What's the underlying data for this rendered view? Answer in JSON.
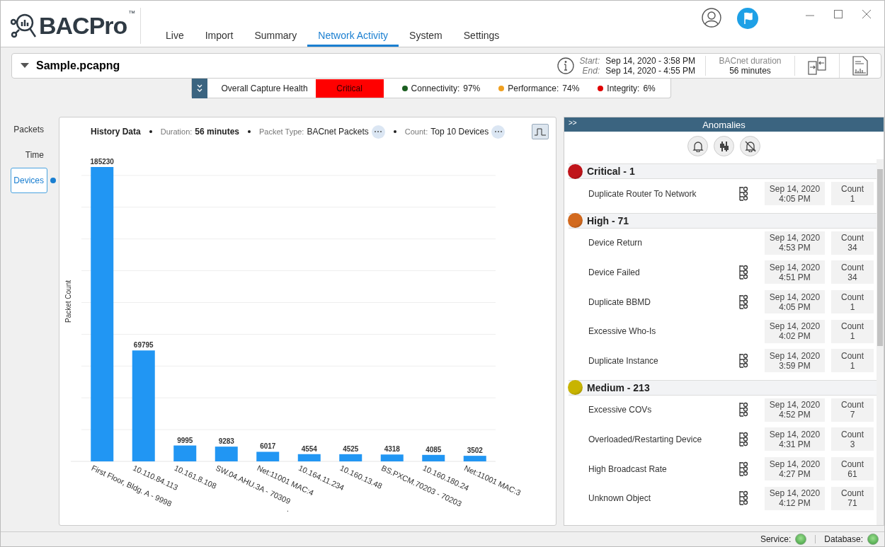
{
  "app": {
    "logo": "BACPro",
    "trademark": "™"
  },
  "tabs": [
    {
      "label": "Live",
      "selected": false
    },
    {
      "label": "Import",
      "selected": false
    },
    {
      "label": "Summary",
      "selected": false
    },
    {
      "label": "Network Activity",
      "selected": true
    },
    {
      "label": "System",
      "selected": false
    },
    {
      "label": "Settings",
      "selected": false
    }
  ],
  "file_bar": {
    "file_name": "Sample.pcapng",
    "start_label": "Start:",
    "start": "Sep 14, 2020 - 3:58 PM",
    "end_label": "End:",
    "end": "Sep 14, 2020 - 4:55 PM",
    "duration_label": "BACnet duration",
    "duration": "56 minutes"
  },
  "health": {
    "label": "Overall Capture Health",
    "status": "Critical",
    "metrics": [
      {
        "label": "Connectivity:",
        "value": "97%",
        "color": "#1b5e20"
      },
      {
        "label": "Performance:",
        "value": "74%",
        "color": "#f0a020"
      },
      {
        "label": "Integrity:",
        "value": "6%",
        "color": "#e00000"
      }
    ]
  },
  "view_tabs": [
    {
      "label": "Packets",
      "selected": false
    },
    {
      "label": "Time",
      "selected": false
    },
    {
      "label": "Devices",
      "selected": true
    }
  ],
  "chart_header": {
    "title": "History Data",
    "duration_label": "Duration:",
    "duration": "56 minutes",
    "packet_type_label": "Packet Type:",
    "packet_type": "BACnet Packets",
    "count_label": "Count:",
    "count": "Top 10 Devices"
  },
  "chart_data": {
    "type": "bar",
    "xlabel": ".",
    "ylabel": "Packet Count",
    "data_labels": true,
    "categories": [
      "First Floor, Bldg. A - 9998",
      "10.110.84.113",
      "10.161.8.108",
      "SW.04.AHU.3A - 70309",
      "Net:11001 MAC:4",
      "10.164.11.234",
      "10.160.13.48",
      "BS.PXCM.70203 - 70203",
      "10.160.180.24",
      "Net:11001 MAC:3"
    ],
    "values": [
      185230,
      69795,
      9995,
      9283,
      6017,
      4554,
      4525,
      4318,
      4085,
      3502
    ]
  },
  "anomalies": {
    "title": "Anomalies",
    "collapse": ">>",
    "groups": [
      {
        "label": "Critical - 1",
        "color": "#c0141a",
        "items": [
          {
            "name": "Duplicate Router To Network",
            "diagram": true,
            "date": "Sep 14, 2020",
            "time": "4:05 PM",
            "count_label": "Count",
            "count": "1"
          }
        ]
      },
      {
        "label": "High - 71",
        "color": "#d2691e",
        "items": [
          {
            "name": "Device Return",
            "diagram": false,
            "date": "Sep 14, 2020",
            "time": "4:53 PM",
            "count_label": "Count",
            "count": "34"
          },
          {
            "name": "Device Failed",
            "diagram": true,
            "date": "Sep 14, 2020",
            "time": "4:51 PM",
            "count_label": "Count",
            "count": "34"
          },
          {
            "name": "Duplicate BBMD",
            "diagram": true,
            "date": "Sep 14, 2020",
            "time": "4:05 PM",
            "count_label": "Count",
            "count": "1"
          },
          {
            "name": "Excessive Who-Is",
            "diagram": false,
            "date": "Sep 14, 2020",
            "time": "4:02 PM",
            "count_label": "Count",
            "count": "1"
          },
          {
            "name": "Duplicate Instance",
            "diagram": true,
            "date": "Sep 14, 2020",
            "time": "3:59 PM",
            "count_label": "Count",
            "count": "1"
          }
        ]
      },
      {
        "label": "Medium - 213",
        "color": "#c8b400",
        "items": [
          {
            "name": "Excessive COVs",
            "diagram": true,
            "date": "Sep 14, 2020",
            "time": "4:52 PM",
            "count_label": "Count",
            "count": "7"
          },
          {
            "name": "Overloaded/Restarting Device",
            "diagram": true,
            "date": "Sep 14, 2020",
            "time": "4:31 PM",
            "count_label": "Count",
            "count": "3"
          },
          {
            "name": "High Broadcast Rate",
            "diagram": true,
            "date": "Sep 14, 2020",
            "time": "4:27 PM",
            "count_label": "Count",
            "count": "61"
          },
          {
            "name": "Unknown Object",
            "diagram": true,
            "date": "Sep 14, 2020",
            "time": "4:12 PM",
            "count_label": "Count",
            "count": "71"
          }
        ]
      }
    ]
  },
  "status_bar": [
    {
      "label": "Service:",
      "on": true
    },
    {
      "label": "Database:",
      "on": true
    }
  ]
}
